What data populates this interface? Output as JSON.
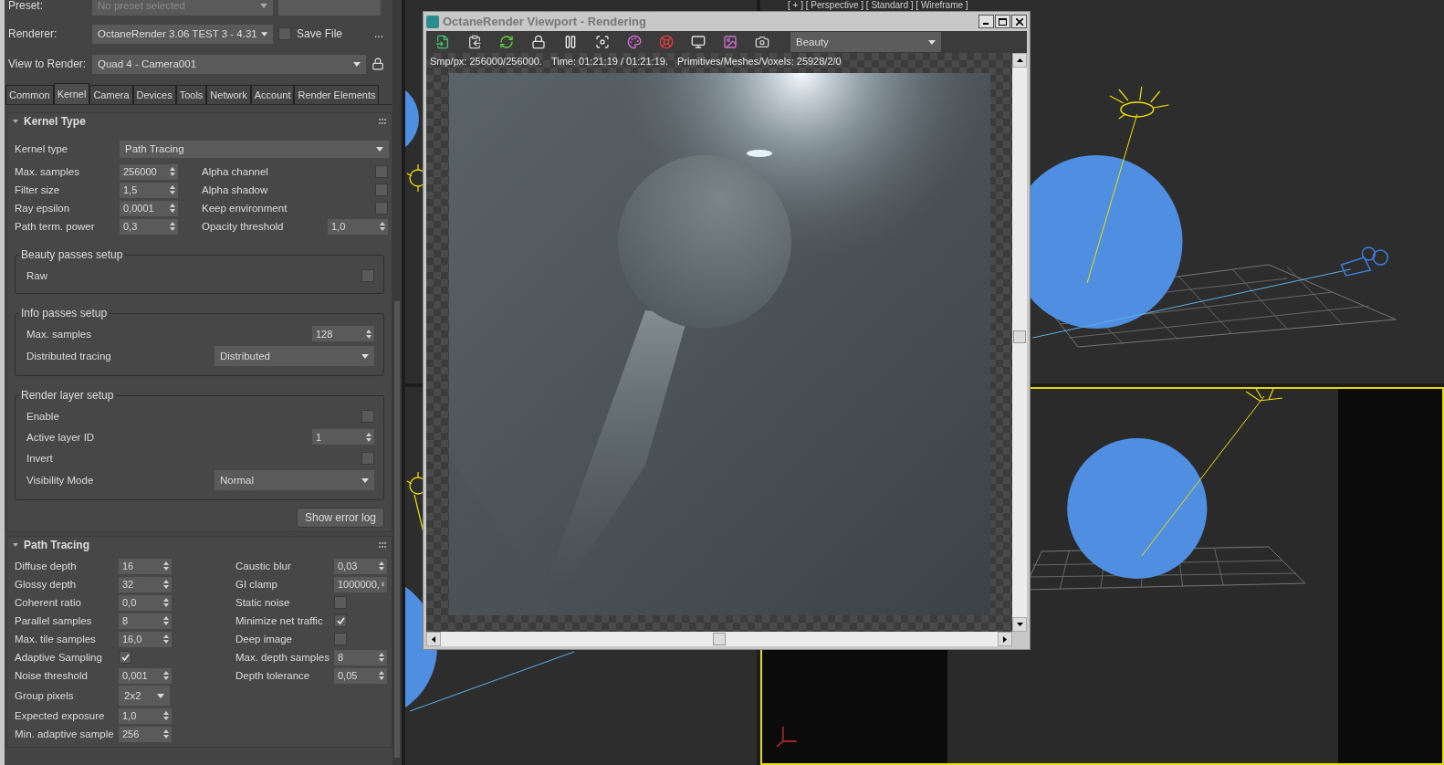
{
  "preset": {
    "label": "Preset:",
    "value": "No preset selected",
    "disabled": true
  },
  "renderer": {
    "label": "Renderer:",
    "value": "OctaneRender 3.06 TEST 3 - 4.31"
  },
  "save_file": {
    "label": "Save File",
    "checked": false
  },
  "more_button": "...",
  "view_to_render": {
    "label": "View to Render:",
    "value": "Quad 4 - Camera001"
  },
  "tabs": [
    {
      "label": "Common",
      "selected": false
    },
    {
      "label": "Kernel",
      "selected": true
    },
    {
      "label": "Camera",
      "selected": false
    },
    {
      "label": "Devices",
      "selected": false
    },
    {
      "label": "Tools",
      "selected": false
    },
    {
      "label": "Network",
      "selected": false
    },
    {
      "label": "Account",
      "selected": false
    },
    {
      "label": "Render Elements",
      "selected": false
    }
  ],
  "rollouts": [
    {
      "title": "Kernel Type",
      "expanded": true,
      "kernel_type": {
        "label": "Kernel type",
        "value": "Path Tracing"
      },
      "left": [
        {
          "kind": "spinner",
          "label": "Max. samples",
          "value": "256000"
        },
        {
          "kind": "spinner",
          "label": "Filter size",
          "value": "1,5"
        },
        {
          "kind": "spinner",
          "label": "Ray epsilon",
          "value": "0,0001"
        },
        {
          "kind": "spinner",
          "label": "Path term. power",
          "value": "0,3"
        }
      ],
      "right": [
        {
          "kind": "checkbox",
          "label": "Alpha channel",
          "checked": false
        },
        {
          "kind": "checkbox",
          "label": "Alpha shadow",
          "checked": false
        },
        {
          "kind": "checkbox",
          "label": "Keep environment",
          "checked": false
        },
        {
          "kind": "spinner",
          "label": "Opacity threshold",
          "value": "1,0"
        }
      ],
      "groups": [
        {
          "title": "Beauty passes setup",
          "fields": [
            {
              "kind": "checkbox",
              "label": "Raw",
              "checked": false
            }
          ]
        },
        {
          "title": "Info passes setup",
          "fields": [
            {
              "kind": "spinner",
              "label": "Max. samples",
              "value": "128"
            },
            {
              "kind": "dropdown",
              "label": "Distributed tracing",
              "value": "Distributed"
            }
          ]
        },
        {
          "title": "Render layer setup",
          "fields": [
            {
              "kind": "checkbox",
              "label": "Enable",
              "checked": false
            },
            {
              "kind": "spinner",
              "label": "Active layer ID",
              "value": "1"
            },
            {
              "kind": "checkbox",
              "label": "Invert",
              "checked": false
            },
            {
              "kind": "dropdown",
              "label": "Visibility Mode",
              "value": "Normal"
            }
          ]
        }
      ],
      "button": "Show error log"
    },
    {
      "title": "Path Tracing",
      "expanded": true,
      "left": [
        {
          "kind": "spinner",
          "label": "Diffuse depth",
          "value": "16"
        },
        {
          "kind": "spinner",
          "label": "Glossy depth",
          "value": "32"
        },
        {
          "kind": "spinner",
          "label": "Coherent ratio",
          "value": "0,0"
        },
        {
          "kind": "spinner",
          "label": "Parallel samples",
          "value": "8"
        },
        {
          "kind": "spinner",
          "label": "Max. tile samples",
          "value": "16,0"
        },
        {
          "kind": "checkbox",
          "label": "Adaptive Sampling",
          "checked": true
        },
        {
          "kind": "spinner",
          "label": "Noise threshold",
          "value": "0,001"
        },
        {
          "kind": "dropdown",
          "label": "Group pixels",
          "value": "2x2"
        },
        {
          "kind": "spinner",
          "label": "Expected exposure",
          "value": "1,0"
        },
        {
          "kind": "spinner",
          "label": "Min. adaptive sample",
          "value": "256"
        }
      ],
      "right": [
        {
          "kind": "spinner",
          "label": "Caustic blur",
          "value": "0,03"
        },
        {
          "kind": "spinner",
          "label": "GI clamp",
          "value": "1000000,"
        },
        {
          "kind": "checkbox",
          "label": "Static noise",
          "checked": false
        },
        {
          "kind": "checkbox",
          "label": "Minimize net traffic",
          "checked": true
        },
        {
          "kind": "checkbox",
          "label": "Deep image",
          "checked": false
        },
        {
          "kind": "spinner",
          "label": "Max. depth samples",
          "value": "8"
        },
        {
          "kind": "spinner",
          "label": "Depth tolerance",
          "value": "0,05"
        }
      ]
    }
  ],
  "viewport_label": "[ + ] [ Perspective ] [ Standard ] [ Wireframe ]",
  "render_window": {
    "title": "OctaneRender Viewport - Rendering",
    "pass": "Beauty",
    "status": [
      "Smp/px: 256000/256000.",
      "Time: 01:21:19 / 01:21:19.",
      "Primitives/Meshes/Voxels: 25928/2/0"
    ]
  }
}
